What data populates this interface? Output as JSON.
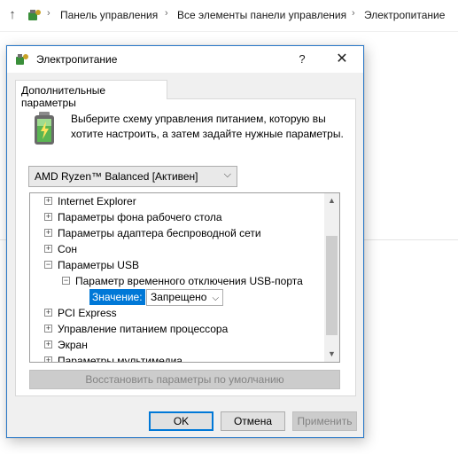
{
  "address_bar": {
    "crumbs": [
      "Панель управления",
      "Все элементы панели управления",
      "Электропитание"
    ]
  },
  "dialog": {
    "title": "Электропитание",
    "help_label": "?",
    "close_label": "✕",
    "tab_label": "Дополнительные параметры",
    "description": "Выберите схему управления питанием, которую вы хотите настроить, а затем задайте нужные параметры.",
    "plan_select": {
      "value": "AMD Ryzen™ Balanced [Активен]"
    },
    "tree": {
      "items": [
        {
          "label": "Internet Explorer",
          "expander": "+"
        },
        {
          "label": "Параметры фона рабочего стола",
          "expander": "+"
        },
        {
          "label": "Параметры адаптера беспроводной сети",
          "expander": "+"
        },
        {
          "label": "Сон",
          "expander": "+"
        },
        {
          "label": "Параметры USB",
          "expander": "−"
        },
        {
          "label": "Параметр временного отключения USB-порта",
          "expander": "−"
        },
        {
          "label": "PCI Express",
          "expander": "+"
        },
        {
          "label": "Управление питанием процессора",
          "expander": "+"
        },
        {
          "label": "Экран",
          "expander": "+"
        },
        {
          "label": "Параметры мультимедиа",
          "expander": "+"
        }
      ],
      "value_label": "Значение:",
      "value_selected": "Запрещено"
    },
    "restore_label": "Восстановить параметры по умолчанию",
    "buttons": {
      "ok": "OK",
      "cancel": "Отмена",
      "apply": "Применить"
    }
  },
  "colors": {
    "accent": "#0078d7",
    "title_border": "#2b79c8",
    "dialog_bg": "#f0f0f0"
  }
}
